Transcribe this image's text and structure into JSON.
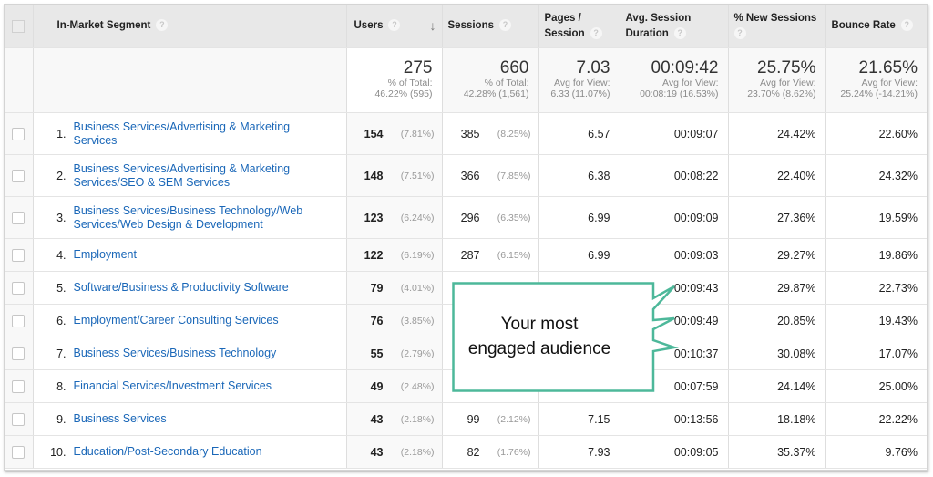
{
  "columns": {
    "segment": "In-Market Segment",
    "users": "Users",
    "sessions": "Sessions",
    "pages_line1": "Pages /",
    "pages_line2": "Session",
    "duration_line1": "Avg. Session",
    "duration_line2": "Duration",
    "new_sessions": "% New Sessions",
    "bounce": "Bounce Rate",
    "help_glyph": "?",
    "sort_icon": "↓"
  },
  "totals": {
    "users": {
      "value": "275",
      "line1": "% of Total:",
      "line2": "46.22% (595)"
    },
    "sessions": {
      "value": "660",
      "line1": "% of Total:",
      "line2": "42.28% (1,561)"
    },
    "pages": {
      "value": "7.03",
      "line1": "Avg for View:",
      "line2": "6.33 (11.07%)"
    },
    "duration": {
      "value": "00:09:42",
      "line1": "Avg for View:",
      "line2": "00:08:19 (16.53%)"
    },
    "new_sessions": {
      "value": "25.75%",
      "line1": "Avg for View:",
      "line2": "23.70% (8.62%)"
    },
    "bounce": {
      "value": "21.65%",
      "line1": "Avg for View:",
      "line2": "25.24% (-14.21%)"
    }
  },
  "rows": [
    {
      "idx": "1.",
      "segment": "Business Services/Advertising & Marketing Services",
      "users": "154",
      "users_pct": "(7.81%)",
      "sessions": "385",
      "sessions_pct": "(8.25%)",
      "pages": "6.57",
      "duration": "00:09:07",
      "new_sessions": "24.42%",
      "bounce": "22.60%"
    },
    {
      "idx": "2.",
      "segment": "Business Services/Advertising & Marketing Services/SEO & SEM Services",
      "users": "148",
      "users_pct": "(7.51%)",
      "sessions": "366",
      "sessions_pct": "(7.85%)",
      "pages": "6.38",
      "duration": "00:08:22",
      "new_sessions": "22.40%",
      "bounce": "24.32%"
    },
    {
      "idx": "3.",
      "segment": "Business Services/Business Technology/Web Services/Web Design & Development",
      "users": "123",
      "users_pct": "(6.24%)",
      "sessions": "296",
      "sessions_pct": "(6.35%)",
      "pages": "6.99",
      "duration": "00:09:09",
      "new_sessions": "27.36%",
      "bounce": "19.59%"
    },
    {
      "idx": "4.",
      "segment": "Employment",
      "users": "122",
      "users_pct": "(6.19%)",
      "sessions": "287",
      "sessions_pct": "(6.15%)",
      "pages": "6.99",
      "duration": "00:09:03",
      "new_sessions": "29.27%",
      "bounce": "19.86%"
    },
    {
      "idx": "5.",
      "segment": "Software/Business & Productivity Software",
      "users": "79",
      "users_pct": "(4.01%)",
      "sessions": "",
      "sessions_pct": "",
      "pages": "",
      "duration": "00:09:43",
      "new_sessions": "29.87%",
      "bounce": "22.73%"
    },
    {
      "idx": "6.",
      "segment": "Employment/Career Consulting Services",
      "users": "76",
      "users_pct": "(3.85%)",
      "sessions": "",
      "sessions_pct": "",
      "pages": "",
      "duration": "00:09:49",
      "new_sessions": "20.85%",
      "bounce": "19.43%"
    },
    {
      "idx": "7.",
      "segment": "Business Services/Business Technology",
      "users": "55",
      "users_pct": "(2.79%)",
      "sessions": "",
      "sessions_pct": "",
      "pages": "",
      "duration": "00:10:37",
      "new_sessions": "30.08%",
      "bounce": "17.07%"
    },
    {
      "idx": "8.",
      "segment": "Financial Services/Investment Services",
      "users": "49",
      "users_pct": "(2.48%)",
      "sessions": "",
      "sessions_pct": "",
      "pages": "",
      "duration": "00:07:59",
      "new_sessions": "24.14%",
      "bounce": "25.00%"
    },
    {
      "idx": "9.",
      "segment": "Business Services",
      "users": "43",
      "users_pct": "(2.18%)",
      "sessions": "99",
      "sessions_pct": "(2.12%)",
      "pages": "7.15",
      "duration": "00:13:56",
      "new_sessions": "18.18%",
      "bounce": "22.22%"
    },
    {
      "idx": "10.",
      "segment": "Education/Post-Secondary Education",
      "users": "43",
      "users_pct": "(2.18%)",
      "sessions": "82",
      "sessions_pct": "(1.76%)",
      "pages": "7.93",
      "duration": "00:09:05",
      "new_sessions": "35.37%",
      "bounce": "9.76%"
    }
  ],
  "callout": {
    "line1": "Your most",
    "line2": "engaged audience",
    "border_color": "#4db89a"
  },
  "colors": {
    "link": "#1a67b8",
    "header_bg": "#e8e8e8"
  }
}
